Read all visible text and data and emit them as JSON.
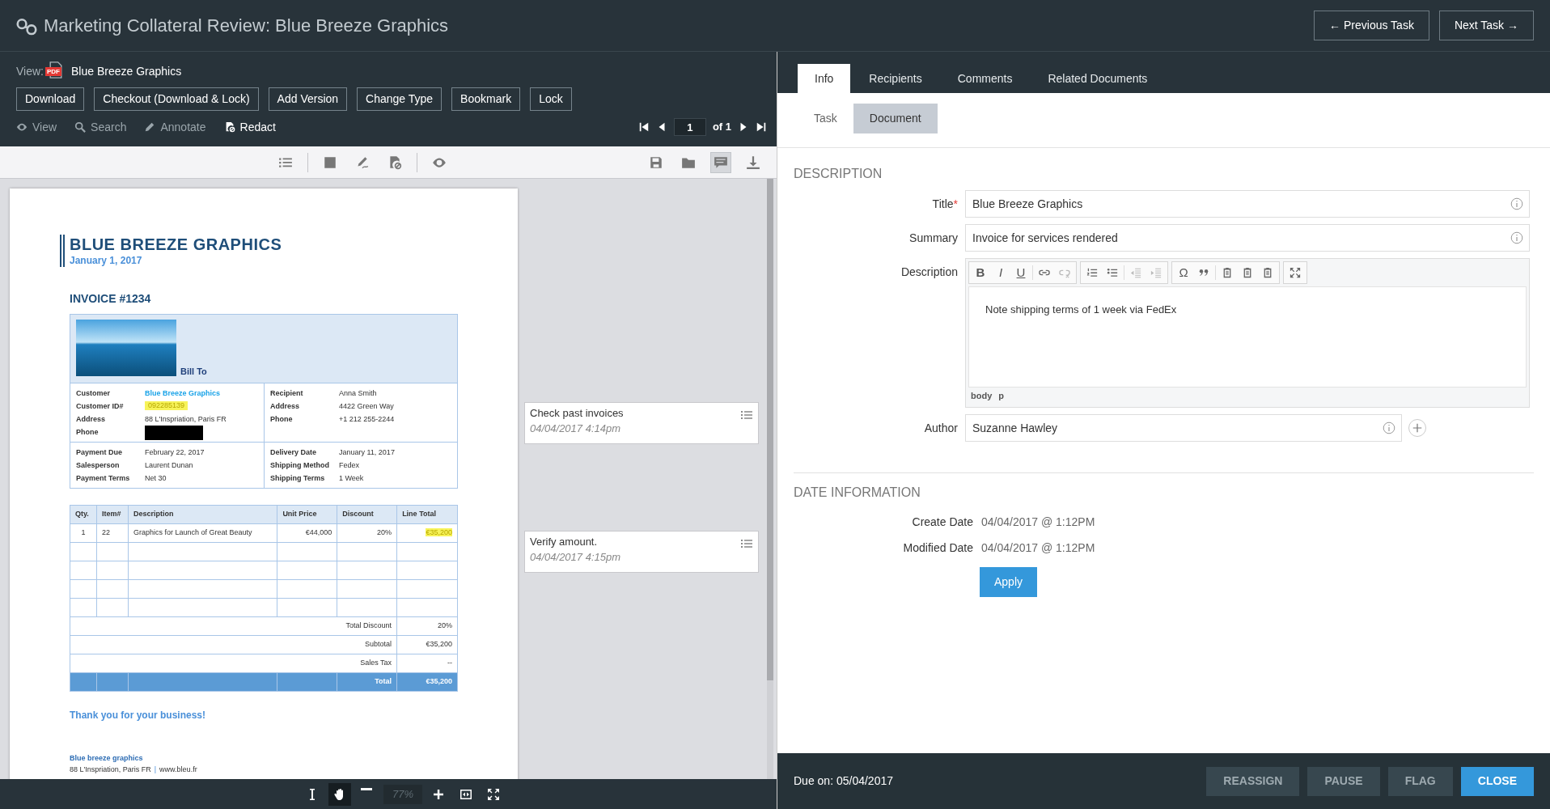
{
  "header": {
    "title": "Marketing Collateral Review: Blue Breeze Graphics",
    "buttons": [
      "← Previous Task",
      "Next Task →"
    ]
  },
  "viewer": {
    "view_label": "View:",
    "file_type": "PDF",
    "file_name": "Blue Breeze Graphics",
    "actions": [
      "Download",
      "Checkout (Download & Lock)",
      "Add Version",
      "Change Type",
      "Bookmark",
      "Lock"
    ],
    "modes": [
      {
        "kind": "view",
        "label": "View",
        "selected": false
      },
      {
        "kind": "search",
        "label": "Search",
        "selected": false
      },
      {
        "kind": "annotate",
        "label": "Annotate",
        "selected": false
      },
      {
        "kind": "redact",
        "label": "Redact",
        "selected": true
      }
    ],
    "page": "1",
    "page_count": "of 1",
    "toolbar": [
      {
        "kind": "outline",
        "selected": false
      },
      {
        "kind": "separator"
      },
      {
        "kind": "box",
        "selected": false
      },
      {
        "kind": "sign",
        "selected": false
      },
      {
        "kind": "redact",
        "selected": false
      },
      {
        "kind": "separator"
      },
      {
        "kind": "eye",
        "selected": false
      },
      {
        "kind": "spacer"
      },
      {
        "kind": "save",
        "selected": false
      },
      {
        "kind": "folder",
        "selected": false
      },
      {
        "kind": "comments",
        "selected": true
      },
      {
        "kind": "download",
        "selected": false
      }
    ],
    "tools": [
      {
        "kind": "text-select",
        "selected": false
      },
      {
        "kind": "pan",
        "selected": true
      },
      {
        "kind": "zoom-out",
        "selected": false
      },
      {
        "kind": "zoom-field"
      },
      {
        "kind": "zoom-in",
        "selected": false
      },
      {
        "kind": "fit",
        "selected": false
      },
      {
        "kind": "fullscreen",
        "selected": false
      }
    ],
    "zoom": "77%",
    "document": {
      "company": "BLUE BREEZE GRAPHICS",
      "date": "January 1, 2017",
      "invoice": "INVOICE #1234",
      "bill_to": "Bill To",
      "detail_blocks": [
        {
          "left": [
            {
              "label": "Customer",
              "value": "Blue Breeze Graphics",
              "kind": "link"
            },
            {
              "label": "Customer ID#",
              "value": "092285139",
              "kind": "highlight"
            },
            {
              "label": "Address",
              "value": "88 L'Inspriation, Paris FR",
              "kind": "text"
            },
            {
              "label": "Phone",
              "kind": "redacted"
            }
          ],
          "right": [
            {
              "label": "Recipient",
              "value": "Anna Smith",
              "kind": "text"
            },
            {
              "label": "Address",
              "value": "4422 Green Way",
              "kind": "text"
            },
            {
              "label": "Phone",
              "value": "+1 212 255-2244",
              "kind": "text"
            }
          ]
        },
        {
          "left": [
            {
              "label": "Payment Due",
              "value": "February 22, 2017",
              "kind": "text"
            },
            {
              "label": "Salesperson",
              "value": "Laurent Dunan",
              "kind": "text"
            },
            {
              "label": "Payment Terms",
              "value": "Net 30",
              "kind": "text"
            }
          ],
          "right": [
            {
              "label": "Delivery Date",
              "value": "January 11, 2017",
              "kind": "text"
            },
            {
              "label": "Shipping Method",
              "value": "Fedex",
              "kind": "text"
            },
            {
              "label": "Shipping Terms",
              "value": "1 Week",
              "kind": "text"
            }
          ]
        }
      ],
      "columns": [
        "Qty.",
        "Item#",
        "Description",
        "Unit Price",
        "Discount",
        "Line Total"
      ],
      "rows": [
        {
          "blank": false,
          "cells": [
            "1",
            "22",
            "Graphics for Launch of Great Beauty",
            "€44,000",
            "20%",
            "€35,200"
          ],
          "highlight_total": true
        },
        {
          "blank": true
        },
        {
          "blank": true
        },
        {
          "blank": true
        },
        {
          "blank": true
        }
      ],
      "totals": [
        {
          "label": "Total Discount",
          "value": "20%",
          "kind": "plain"
        },
        {
          "label": "Subtotal",
          "value": "€35,200",
          "kind": "plain"
        },
        {
          "label": "Sales Tax",
          "value": "--",
          "kind": "plain"
        },
        {
          "label": "Total",
          "value": "€35,200",
          "kind": "grand"
        }
      ],
      "thanks": "Thank you for your business!",
      "footer_company": "Blue breeze graphics",
      "footer_address": "88 L'Inspriation, Paris FR",
      "footer_separator": "|",
      "footer_website": "www.bleu.fr"
    },
    "comments": [
      {
        "text": "Check past invoices",
        "time": "04/04/2017 4:14pm"
      },
      {
        "text": "Verify amount.",
        "time": "04/04/2017 4:15pm"
      }
    ]
  },
  "panel": {
    "tabs": [
      {
        "label": "Info",
        "selected": true
      },
      {
        "label": "Recipients",
        "selected": false
      },
      {
        "label": "Comments",
        "selected": false
      },
      {
        "label": "Related Documents",
        "selected": false
      }
    ],
    "subtabs": [
      {
        "label": "Task",
        "selected": false
      },
      {
        "label": "Document",
        "selected": true
      }
    ],
    "sections": [
      {
        "heading": "DESCRIPTION",
        "fields": [
          {
            "kind": "input",
            "label": "Title",
            "required_mark": "*",
            "value": "Blue Breeze Graphics"
          },
          {
            "kind": "input",
            "label": "Summary",
            "value": "Invoice for services rendered"
          },
          {
            "kind": "editor",
            "label": "Description",
            "value": "Note shipping terms of 1 week via FedEx",
            "format_buttons": [
              "B",
              "I",
              "U"
            ],
            "symbol_button": "Ω",
            "path": [
              "body",
              "p"
            ]
          },
          {
            "kind": "person",
            "label": "Author",
            "value": "Suzanne Hawley"
          }
        ]
      },
      {
        "heading": "DATE INFORMATION",
        "fields": [
          {
            "kind": "static",
            "label": "Create Date",
            "value": "04/04/2017 @ 1:12PM"
          },
          {
            "kind": "static",
            "label": "Modified Date",
            "value": "04/04/2017 @ 1:12PM"
          }
        ]
      }
    ],
    "apply": "Apply",
    "footer": {
      "due": "Due on: 05/04/2017",
      "buttons": [
        {
          "label": "REASSIGN",
          "primary": false
        },
        {
          "label": "PAUSE",
          "primary": false
        },
        {
          "label": "FLAG",
          "primary": false
        },
        {
          "label": "CLOSE",
          "primary": true
        }
      ]
    }
  }
}
